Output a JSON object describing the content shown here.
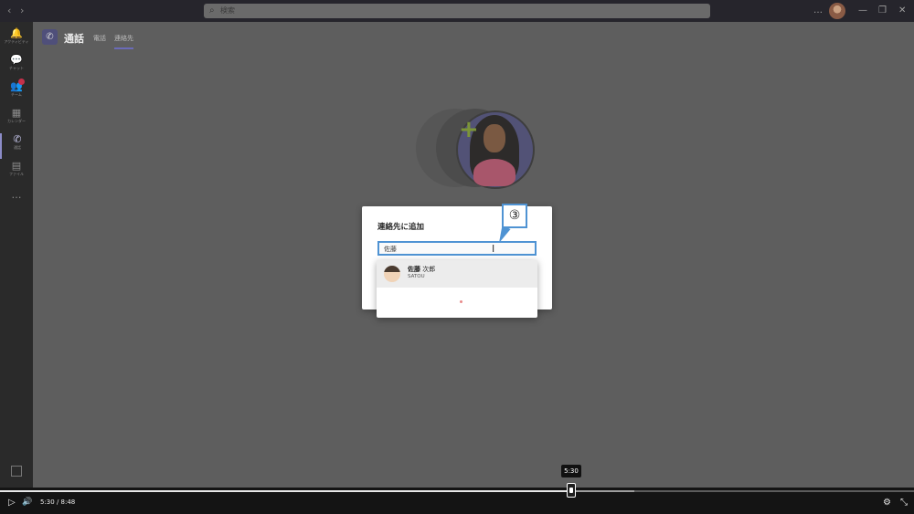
{
  "titlebar": {
    "search_placeholder": "検索",
    "back_glyph": "‹",
    "forward_glyph": "›",
    "window_controls": {
      "more": "…",
      "minimize": "—",
      "restore": "❐",
      "close": "✕"
    }
  },
  "rail": {
    "items": [
      {
        "label": "アクティビティ",
        "icon": "bell-icon",
        "glyph": "🔔"
      },
      {
        "label": "チャット",
        "icon": "chat-icon",
        "glyph": "💬"
      },
      {
        "label": "チーム",
        "icon": "teams-icon",
        "glyph": "👥"
      },
      {
        "label": "カレンダー",
        "icon": "calendar-icon",
        "glyph": "▦"
      },
      {
        "label": "通話",
        "icon": "phone-icon",
        "glyph": "✆"
      },
      {
        "label": "ファイル",
        "icon": "file-icon",
        "glyph": "▤"
      }
    ],
    "more": "…"
  },
  "header": {
    "title": "通話",
    "tabs": [
      "電話",
      "連絡先"
    ]
  },
  "dialog": {
    "title": "連絡先に追加",
    "input_value": "佐藤",
    "cursor_glyph": "I"
  },
  "callout": {
    "number": "③"
  },
  "suggestion": {
    "name_bold": "佐藤",
    "name_rest": " 次郎",
    "sub": "SATOU"
  },
  "player": {
    "current_time": "5:30",
    "duration": "8:48",
    "time_display": "5:30  /  8:48",
    "tooltip": "5:30",
    "progress_fraction": 0.625,
    "buffered_fraction": 0.694,
    "play_glyph": "▷",
    "volume_glyph": "🔊",
    "settings_glyph": "⚙",
    "exit_fullscreen_glyph": "⤡"
  },
  "colors": {
    "accent": "#4f93d3",
    "brand": "#6264a7",
    "alert": "#c4314b"
  }
}
